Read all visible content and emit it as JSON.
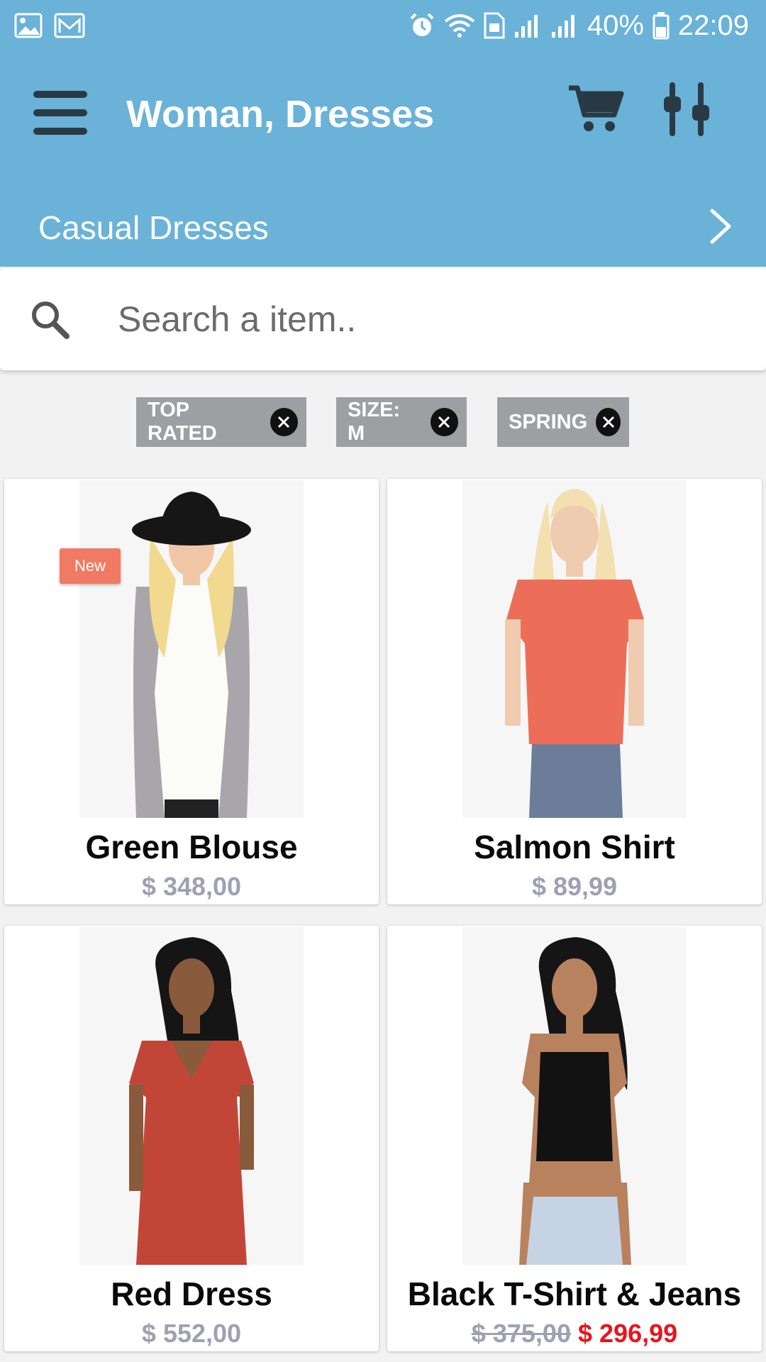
{
  "status_bar": {
    "battery": "40%",
    "time": "22:09"
  },
  "app_bar": {
    "title": "Woman, Dresses",
    "subcategory": "Casual Dresses"
  },
  "search": {
    "placeholder": "Search a item.."
  },
  "filters": [
    {
      "label": "TOP RATED"
    },
    {
      "label": "SIZE: M"
    },
    {
      "label": "SPRING"
    }
  ],
  "products": [
    {
      "name": "Green Blouse",
      "price": "$ 348,00",
      "badge": "New"
    },
    {
      "name": "Salmon Shirt",
      "price": "$ 89,99"
    },
    {
      "name": "Red Dress",
      "price": "$ 552,00"
    },
    {
      "name": "Black T-Shirt & Jeans",
      "old_price": "$ 375,00",
      "sale_price": "$ 296,99"
    }
  ],
  "colors": {
    "app_bar": "#6ab2d8",
    "chip": "#9e9fa3",
    "badge_new": "#f07a64",
    "price": "#9ea0b4",
    "sale_price": "#e8141c"
  }
}
